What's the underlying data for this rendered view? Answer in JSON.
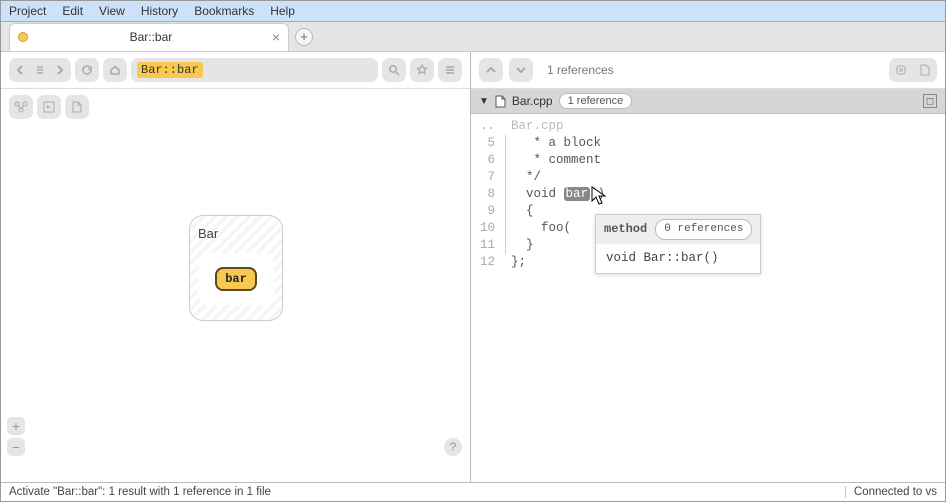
{
  "menu": {
    "items": [
      "Project",
      "Edit",
      "View",
      "History",
      "Bookmarks",
      "Help"
    ]
  },
  "tabs": {
    "active": {
      "title": "Bar::bar"
    }
  },
  "search": {
    "query": "Bar::bar"
  },
  "graph": {
    "class_label": "Bar",
    "method_label": "bar"
  },
  "refs": {
    "header": "1 references"
  },
  "file": {
    "name": "Bar.cpp",
    "ref_badge": "1 reference",
    "path_hint": "Bar.cpp",
    "lines": [
      {
        "n": "..",
        "text": "Bar.cpp",
        "faded": true,
        "noscope": true
      },
      {
        "n": "5",
        "text": "   * a block"
      },
      {
        "n": "6",
        "text": "   * comment"
      },
      {
        "n": "7",
        "text": "  */"
      },
      {
        "n": "8",
        "pre": "  void ",
        "hl": "bar",
        "post": "()"
      },
      {
        "n": "9",
        "text": "  {"
      },
      {
        "n": "10",
        "text": "    foo("
      },
      {
        "n": "11",
        "text": "  }"
      },
      {
        "n": "12",
        "text": "};",
        "noscope": true
      }
    ]
  },
  "tooltip": {
    "kind": "method",
    "badge": "0 references",
    "sig": "void Bar::bar()"
  },
  "status": {
    "text": "Activate \"Bar::bar\": 1 result with 1 reference in 1 file",
    "connection": "Connected to vs"
  }
}
